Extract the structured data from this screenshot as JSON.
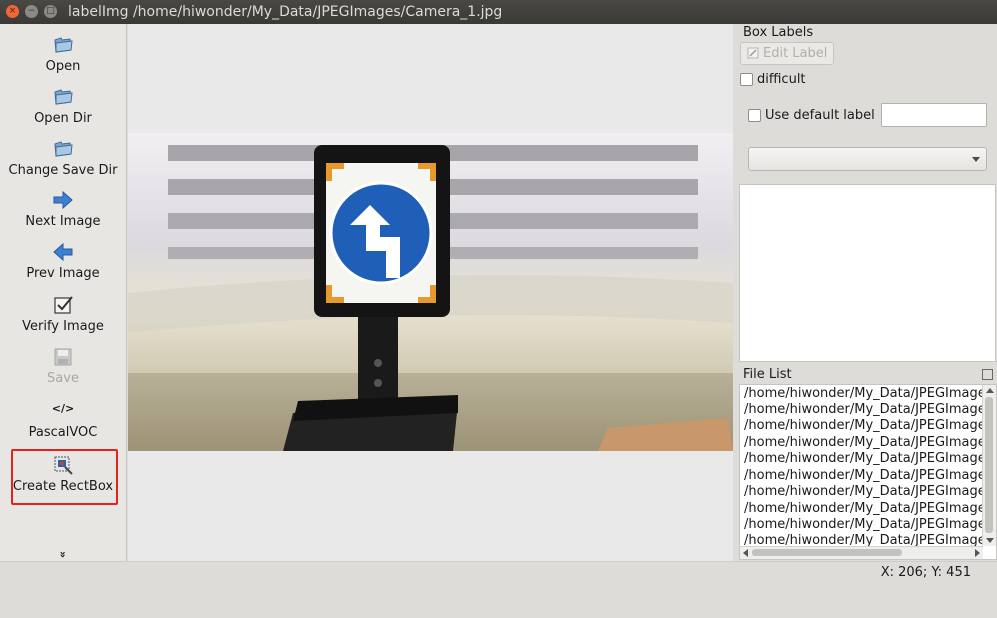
{
  "window": {
    "title": "labelImg /home/hiwonder/My_Data/JPEGImages/Camera_1.jpg",
    "close_glyph": "×",
    "min_glyph": "−",
    "max_glyph": "□"
  },
  "toolbar": {
    "open": "Open",
    "open_dir": "Open Dir",
    "change_save_dir": "Change Save Dir",
    "next_image": "Next Image",
    "prev_image": "Prev Image",
    "verify_image": "Verify Image",
    "save": "Save",
    "format_icon_text": "</>",
    "format": "PascalVOC",
    "create_rectbox": "Create RectBox",
    "more_glyph": "»"
  },
  "right_panel": {
    "box_labels_title": "Box Labels",
    "edit_label_button": "Edit Label",
    "difficult_label": "difficult",
    "use_default_label": "Use default label",
    "default_label_value": "",
    "label_combo_value": "",
    "file_list_title": "File List",
    "file_list": [
      "/home/hiwonder/My_Data/JPEGImage",
      "/home/hiwonder/My_Data/JPEGImage",
      "/home/hiwonder/My_Data/JPEGImage",
      "/home/hiwonder/My_Data/JPEGImage",
      "/home/hiwonder/My_Data/JPEGImage",
      "/home/hiwonder/My_Data/JPEGImage",
      "/home/hiwonder/My_Data/JPEGImage",
      "/home/hiwonder/My_Data/JPEGImage",
      "/home/hiwonder/My_Data/JPEGImage",
      "/home/hiwonder/My_Data/JPEGImage"
    ]
  },
  "status": {
    "coords": "X: 206; Y: 451"
  },
  "colors": {
    "highlight": "#e3231d",
    "sign_blue": "#1f5fb8",
    "sign_orange": "#e69a2e"
  }
}
